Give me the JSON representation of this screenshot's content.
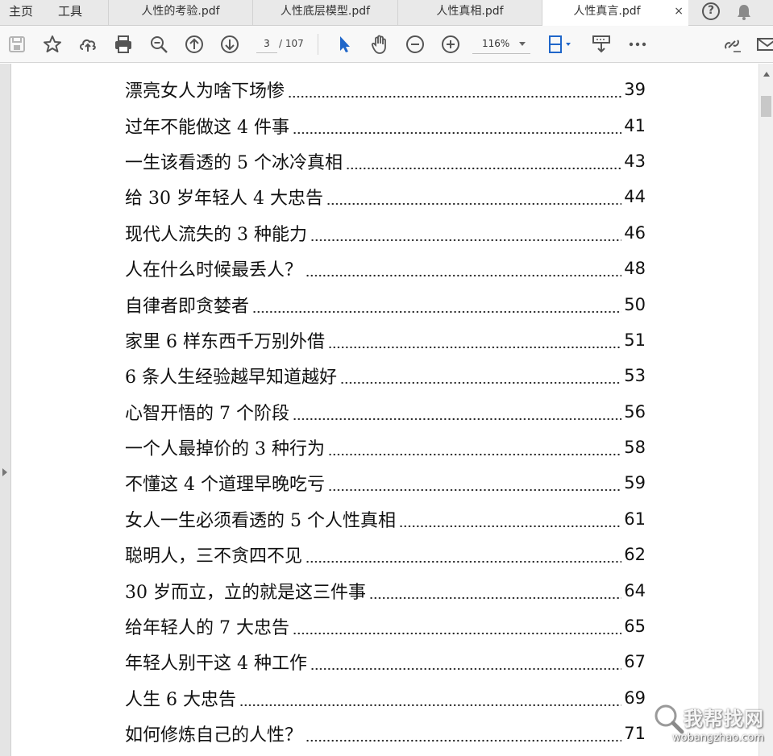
{
  "menu": {
    "home": "主页",
    "tools": "工具"
  },
  "tabs": [
    {
      "label": "人性的考验.pdf",
      "active": false
    },
    {
      "label": "人性底层模型.pdf",
      "active": false
    },
    {
      "label": "人性真相.pdf",
      "active": false
    },
    {
      "label": "人性真言.pdf",
      "active": true
    }
  ],
  "tab_close_glyph": "×",
  "help_glyph": "?",
  "toolbar": {
    "current_page": "3",
    "page_total": "/ 107",
    "zoom": "116%"
  },
  "accent_color": "#1f66c9",
  "toc": [
    {
      "title": "漂亮女人为啥下场惨",
      "page": "39"
    },
    {
      "title": "过年不能做这 4 件事",
      "page": "41"
    },
    {
      "title": "一生该看透的 5 个冰冷真相",
      "page": "43"
    },
    {
      "title": "给 30 岁年轻人 4 大忠告",
      "page": "44"
    },
    {
      "title": "现代人流失的 3 种能力",
      "page": "46"
    },
    {
      "title": "人在什么时候最丢人？",
      "page": "48"
    },
    {
      "title": "自律者即贪婪者",
      "page": "50"
    },
    {
      "title": "家里 6 样东西千万别外借",
      "page": "51"
    },
    {
      "title": "6 条人生经验越早知道越好",
      "page": "53"
    },
    {
      "title": "心智开悟的 7 个阶段",
      "page": "56"
    },
    {
      "title": "一个人最掉价的 3 种行为",
      "page": "58"
    },
    {
      "title": "不懂这 4 个道理早晚吃亏",
      "page": "59"
    },
    {
      "title": "女人一生必须看透的 5 个人性真相",
      "page": "61"
    },
    {
      "title": "聪明人，三不贪四不见",
      "page": "62"
    },
    {
      "title": "30 岁而立，立的就是这三件事",
      "page": "64"
    },
    {
      "title": "给年轻人的 7 大忠告",
      "page": "65"
    },
    {
      "title": "年轻人别干这 4 种工作",
      "page": "67"
    },
    {
      "title": "人生 6 大忠告",
      "page": "69"
    },
    {
      "title": "如何修炼自己的人性？",
      "page": "71"
    }
  ],
  "watermark": {
    "cn": "我帮找网",
    "en": "wobangzhao.com"
  }
}
